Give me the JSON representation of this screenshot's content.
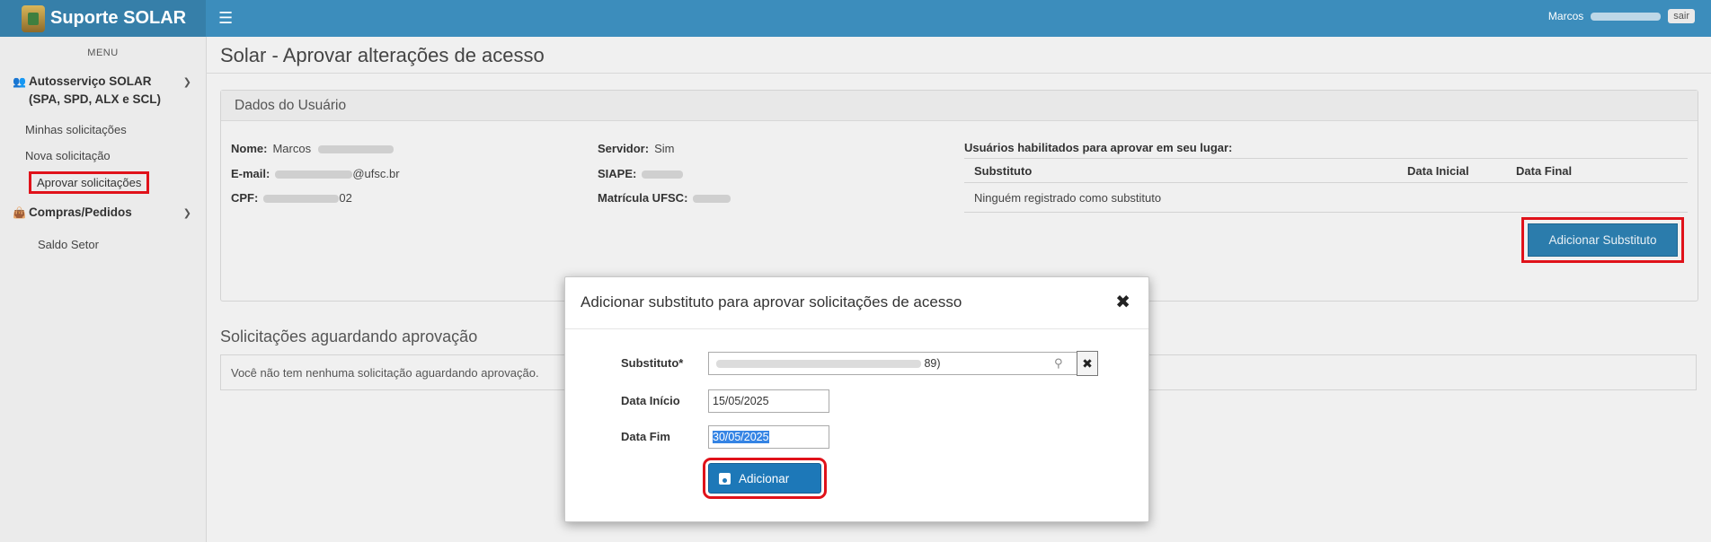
{
  "app": {
    "title": "Suporte SOLAR"
  },
  "header": {
    "user_name": "Marcos",
    "logout_label": "sair"
  },
  "sidebar": {
    "menu_label": "MENU",
    "groups": [
      {
        "label": "Autosserviço SOLAR (SPA, SPD, ALX e SCL)",
        "items": [
          {
            "label": "Minhas solicitações"
          },
          {
            "label": "Nova solicitação"
          },
          {
            "label": "Aprovar solicitações"
          }
        ]
      },
      {
        "label": "Compras/Pedidos",
        "items": [
          {
            "label": "Saldo Setor"
          }
        ]
      }
    ]
  },
  "page": {
    "title": "Solar - Aprovar alterações de acesso"
  },
  "user_panel": {
    "title": "Dados do Usuário",
    "nome_label": "Nome:",
    "nome_value": "Marcos",
    "email_label": "E-mail:",
    "email_value": "@ufsc.br",
    "cpf_label": "CPF:",
    "cpf_value": "02",
    "servidor_label": "Servidor:",
    "servidor_value": "Sim",
    "siape_label": "SIAPE:",
    "matricula_label": "Matrícula UFSC:",
    "substitutes_title": "Usuários habilitados para aprovar em seu lugar:",
    "table_headers": [
      "Substituto",
      "Data Inicial",
      "Data Final"
    ],
    "empty_row": "Ninguém registrado como substituto",
    "add_substitute_label": "Adicionar Substituto"
  },
  "pending": {
    "title": "Solicitações aguardando aprovação",
    "empty_text": "Você não tem nenhuma solicitação aguardando aprovação."
  },
  "modal": {
    "title": "Adicionar substituto para aprovar solicitações de acesso",
    "substituto_label": "Substituto*",
    "substituto_value": "89)",
    "data_inicio_label": "Data Início",
    "data_inicio_value": "15/05/2025",
    "data_fim_label": "Data Fim",
    "data_fim_value": "30/05/2025",
    "submit_label": "Adicionar"
  },
  "colors": {
    "header": "#3c8dbc",
    "highlight": "#e0121a",
    "primary_button": "#1d78b8"
  }
}
